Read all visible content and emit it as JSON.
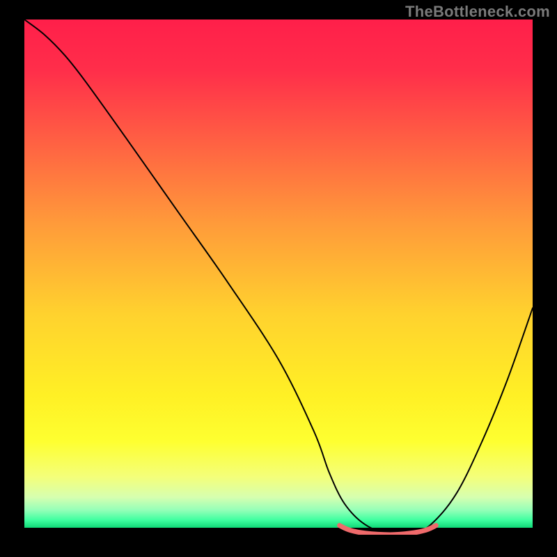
{
  "watermark": "TheBottleneck.com",
  "gradient_stops": [
    {
      "offset": 0.0,
      "color": "#ff1f4a"
    },
    {
      "offset": 0.1,
      "color": "#ff2e4a"
    },
    {
      "offset": 0.22,
      "color": "#ff5944"
    },
    {
      "offset": 0.4,
      "color": "#ff9a3a"
    },
    {
      "offset": 0.58,
      "color": "#ffd22e"
    },
    {
      "offset": 0.74,
      "color": "#fff025"
    },
    {
      "offset": 0.83,
      "color": "#feff30"
    },
    {
      "offset": 0.9,
      "color": "#f4ff7a"
    },
    {
      "offset": 0.94,
      "color": "#d6ffb0"
    },
    {
      "offset": 0.965,
      "color": "#95ffb8"
    },
    {
      "offset": 0.985,
      "color": "#3effa0"
    },
    {
      "offset": 1.0,
      "color": "#10d977"
    }
  ],
  "chart_data": {
    "type": "line",
    "title": "",
    "xlabel": "",
    "ylabel": "",
    "xlim": [
      0,
      100
    ],
    "ylim": [
      0,
      100
    ],
    "grid": false,
    "series": [
      {
        "name": "bottleneck-curve",
        "color": "#000000",
        "width": 2,
        "x": [
          0,
          4,
          8,
          12,
          20,
          30,
          40,
          50,
          57,
          60,
          63,
          67,
          72,
          76,
          80,
          85,
          90,
          95,
          100
        ],
        "y": [
          100,
          97,
          93,
          88,
          77,
          63,
          49,
          34,
          20,
          12,
          6,
          2,
          0,
          0,
          2,
          8,
          18,
          30,
          44
        ]
      },
      {
        "name": "flat-minimum-marker",
        "color": "#ef6a6b",
        "width": 7,
        "x": [
          62,
          64,
          67,
          72,
          76,
          79,
          81
        ],
        "y": [
          1.8,
          0.9,
          0.3,
          0.0,
          0.3,
          0.9,
          1.8
        ]
      }
    ]
  }
}
